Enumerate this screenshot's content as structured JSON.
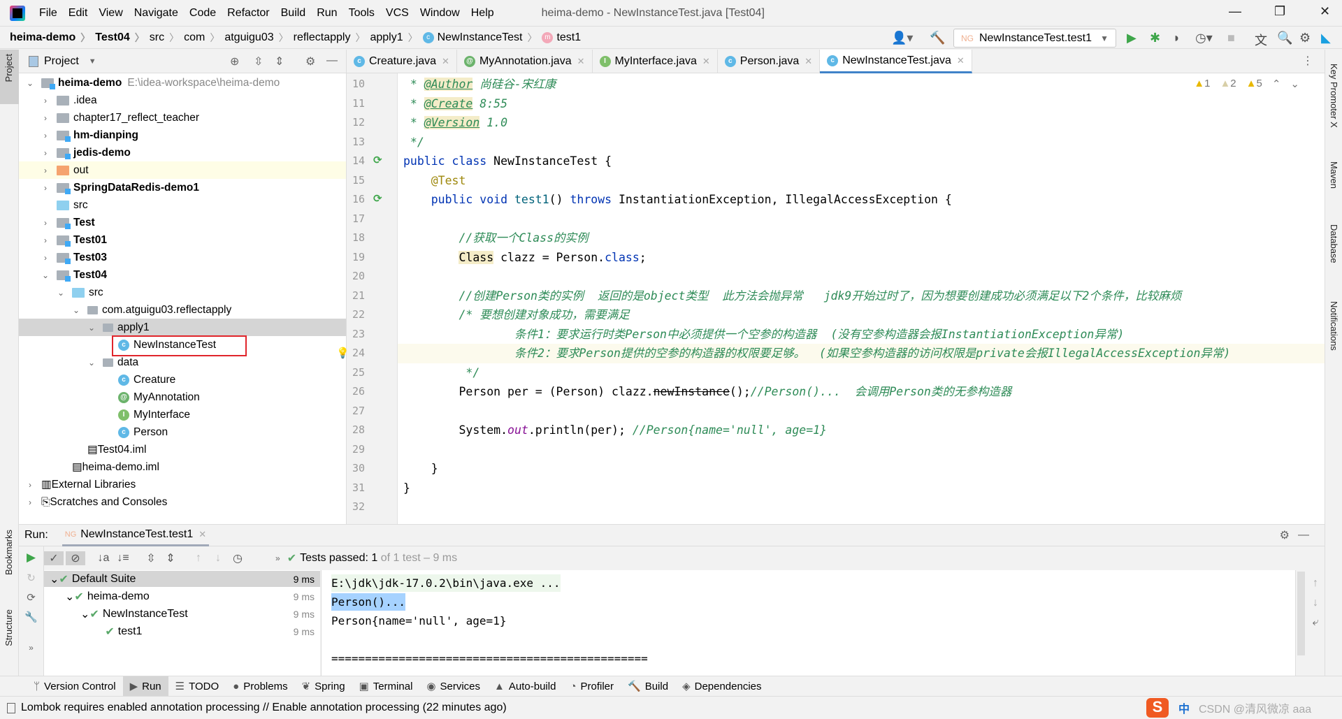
{
  "menu": {
    "items": [
      "File",
      "Edit",
      "View",
      "Navigate",
      "Code",
      "Refactor",
      "Build",
      "Run",
      "Tools",
      "VCS",
      "Window",
      "Help"
    ],
    "title": "heima-demo - NewInstanceTest.java [Test04]"
  },
  "breadcrumb": [
    "heima-demo",
    "Test04",
    "src",
    "com",
    "atguigu03",
    "reflectapply",
    "apply1",
    "NewInstanceTest",
    "test1"
  ],
  "run_config": "NewInstanceTest.test1",
  "left_stripe": {
    "project": "Project",
    "bookmarks": "Bookmarks",
    "structure": "Structure"
  },
  "right_stripe": [
    "Key Promoter X",
    "Maven",
    "Database",
    "Notifications"
  ],
  "project": {
    "title": "Project",
    "tree": [
      {
        "label": "heima-demo",
        "path": "E:\\idea-workspace\\heima-demo",
        "depth": 0,
        "arrow": "down",
        "icon": "module",
        "bold": true
      },
      {
        "label": ".idea",
        "depth": 1,
        "arrow": "right",
        "icon": "folder"
      },
      {
        "label": "chapter17_reflect_teacher",
        "depth": 1,
        "arrow": "right",
        "icon": "folder"
      },
      {
        "label": "hm-dianping",
        "depth": 1,
        "arrow": "right",
        "icon": "module",
        "bold": true
      },
      {
        "label": "jedis-demo",
        "depth": 1,
        "arrow": "right",
        "icon": "module",
        "bold": true
      },
      {
        "label": "out",
        "depth": 1,
        "arrow": "right",
        "icon": "orange",
        "hl": true
      },
      {
        "label": "SpringDataRedis-demo1",
        "depth": 1,
        "arrow": "right",
        "icon": "module",
        "bold": true
      },
      {
        "label": "src",
        "depth": 1,
        "arrow": "",
        "icon": "blue"
      },
      {
        "label": "Test",
        "depth": 1,
        "arrow": "right",
        "icon": "module",
        "bold": true
      },
      {
        "label": "Test01",
        "depth": 1,
        "arrow": "right",
        "icon": "module",
        "bold": true
      },
      {
        "label": "Test03",
        "depth": 1,
        "arrow": "right",
        "icon": "module",
        "bold": true
      },
      {
        "label": "Test04",
        "depth": 1,
        "arrow": "down",
        "icon": "module",
        "bold": true
      },
      {
        "label": "src",
        "depth": 2,
        "arrow": "down",
        "icon": "blue"
      },
      {
        "label": "com.atguigu03.reflectapply",
        "depth": 3,
        "arrow": "down",
        "icon": "pkg"
      },
      {
        "label": "apply1",
        "depth": 4,
        "arrow": "down",
        "icon": "pkg",
        "sel": true
      },
      {
        "label": "NewInstanceTest",
        "depth": 5,
        "arrow": "",
        "icon": "class"
      },
      {
        "label": "data",
        "depth": 4,
        "arrow": "down",
        "icon": "pkg"
      },
      {
        "label": "Creature",
        "depth": 5,
        "arrow": "",
        "icon": "class"
      },
      {
        "label": "MyAnnotation",
        "depth": 5,
        "arrow": "",
        "icon": "annotation"
      },
      {
        "label": "MyInterface",
        "depth": 5,
        "arrow": "",
        "icon": "interface"
      },
      {
        "label": "Person",
        "depth": 5,
        "arrow": "",
        "icon": "class"
      },
      {
        "label": "Test04.iml",
        "depth": 3,
        "arrow": "",
        "icon": "iml"
      },
      {
        "label": "heima-demo.iml",
        "depth": 2,
        "arrow": "",
        "icon": "iml"
      },
      {
        "label": "External Libraries",
        "depth": 0,
        "arrow": "right",
        "icon": "lib"
      },
      {
        "label": "Scratches and Consoles",
        "depth": 0,
        "arrow": "right",
        "icon": "scratch"
      }
    ]
  },
  "editor": {
    "tabs": [
      {
        "label": "Creature.java",
        "icon": "class"
      },
      {
        "label": "MyAnnotation.java",
        "icon": "annotation"
      },
      {
        "label": "MyInterface.java",
        "icon": "interface"
      },
      {
        "label": "Person.java",
        "icon": "class"
      },
      {
        "label": "NewInstanceTest.java",
        "icon": "class",
        "active": true
      }
    ],
    "inspections": {
      "errors": "1",
      "weak": "2",
      "warnings": "5"
    },
    "current_line": 24,
    "lines": [
      {
        "n": 10,
        "s": [
          [
            " * ",
            "doc"
          ],
          [
            "@Author",
            "tag"
          ],
          [
            " 尚硅谷-宋红康",
            "doc"
          ]
        ]
      },
      {
        "n": 11,
        "s": [
          [
            " * ",
            "doc"
          ],
          [
            "@Create",
            "tag"
          ],
          [
            " 8:55",
            "doc"
          ]
        ]
      },
      {
        "n": 12,
        "s": [
          [
            " * ",
            "doc"
          ],
          [
            "@Version",
            "tag"
          ],
          [
            " 1.0",
            "doc"
          ]
        ]
      },
      {
        "n": 13,
        "s": [
          [
            " */",
            "doc"
          ]
        ]
      },
      {
        "n": 14,
        "s": [
          [
            "public class ",
            "kw"
          ],
          [
            "NewInstanceTest {",
            ""
          ]
        ],
        "run": true
      },
      {
        "n": 15,
        "s": [
          [
            "    ",
            ""
          ],
          [
            "@Test",
            "ann"
          ]
        ]
      },
      {
        "n": 16,
        "s": [
          [
            "    ",
            ""
          ],
          [
            "public void ",
            "kw"
          ],
          [
            "test1",
            "fn"
          ],
          [
            "() ",
            ""
          ],
          [
            "throws ",
            "kw"
          ],
          [
            "InstantiationException, IllegalAccessException {",
            ""
          ]
        ],
        "run": true
      },
      {
        "n": 17,
        "s": []
      },
      {
        "n": 18,
        "s": [
          [
            "        ",
            ""
          ],
          [
            "//获取一个Class的实例",
            "cm"
          ]
        ]
      },
      {
        "n": 19,
        "s": [
          [
            "        ",
            ""
          ],
          [
            "Class",
            "hlc"
          ],
          [
            " clazz = Person.",
            ""
          ],
          [
            "class",
            "kw"
          ],
          [
            ";",
            ""
          ]
        ]
      },
      {
        "n": 20,
        "s": []
      },
      {
        "n": 21,
        "s": [
          [
            "        ",
            ""
          ],
          [
            "//创建Person类的实例  返回的是object类型  此方法会抛异常   jdk9开始过时了，因为想要创建成功必须满足以下2个条件，比较麻烦",
            "cm"
          ]
        ]
      },
      {
        "n": 22,
        "s": [
          [
            "        ",
            ""
          ],
          [
            "/* 要想创建对象成功，需要满足",
            "cm"
          ]
        ]
      },
      {
        "n": 23,
        "s": [
          [
            "                ",
            ""
          ],
          [
            "条件1：要求运行时类Person中必须提供一个空参的构造器  (没有空参构造器会报InstantiationException异常)",
            "cm"
          ]
        ]
      },
      {
        "n": 24,
        "s": [
          [
            "                ",
            ""
          ],
          [
            "条件2：要求Person提供的空参的构造器的权限要足够。  (如果空参构造器的访问权限是private会报IllegalAccessException异常)",
            "cm"
          ]
        ],
        "bulb": true
      },
      {
        "n": 25,
        "s": [
          [
            "         */",
            "cm"
          ]
        ]
      },
      {
        "n": 26,
        "s": [
          [
            "        Person per = (Person) clazz.",
            ""
          ],
          [
            "newInstance",
            "strike"
          ],
          [
            "();",
            ""
          ],
          [
            "//Person()...  会调用Person类的无参构造器",
            "cm"
          ]
        ]
      },
      {
        "n": 27,
        "s": []
      },
      {
        "n": 28,
        "s": [
          [
            "        System.",
            ""
          ],
          [
            "out",
            "field"
          ],
          [
            ".println(per); ",
            ""
          ],
          [
            "//Person{name='null', age=1}",
            "cm"
          ]
        ]
      },
      {
        "n": 29,
        "s": []
      },
      {
        "n": 30,
        "s": [
          [
            "    }",
            ""
          ]
        ]
      },
      {
        "n": 31,
        "s": [
          [
            "}",
            ""
          ]
        ]
      },
      {
        "n": 32,
        "s": []
      }
    ]
  },
  "run": {
    "label": "Run:",
    "tab": "NewInstanceTest.test1",
    "status_label": "Tests passed:",
    "status_count": "1",
    "status_rest": "of 1 test – 9 ms",
    "tree": [
      {
        "label": "Default Suite",
        "time": "9 ms",
        "depth": 0
      },
      {
        "label": "heima-demo",
        "time": "9 ms",
        "depth": 1
      },
      {
        "label": "NewInstanceTest",
        "time": "9 ms",
        "depth": 2
      },
      {
        "label": "test1",
        "time": "9 ms",
        "depth": 3
      }
    ],
    "console": [
      "E:\\jdk\\jdk-17.0.2\\bin\\java.exe ...",
      "Person()...",
      "Person{name='null', age=1}",
      "",
      "==============================================="
    ]
  },
  "bottom_tools": [
    {
      "label": "Version Control",
      "icon": "vcs"
    },
    {
      "label": "Run",
      "icon": "run",
      "active": true
    },
    {
      "label": "TODO",
      "icon": "todo"
    },
    {
      "label": "Problems",
      "icon": "problems"
    },
    {
      "label": "Spring",
      "icon": "spring"
    },
    {
      "label": "Terminal",
      "icon": "terminal"
    },
    {
      "label": "Services",
      "icon": "services"
    },
    {
      "label": "Auto-build",
      "icon": "auto-build"
    },
    {
      "label": "Profiler",
      "icon": "profiler"
    },
    {
      "label": "Build",
      "icon": "build"
    },
    {
      "label": "Dependencies",
      "icon": "dependencies"
    }
  ],
  "status": {
    "message": "Lombok requires enabled annotation processing // Enable annotation processing (22 minutes ago)",
    "ime": "中"
  },
  "watermark": "CSDN @清风微凉 aaa"
}
